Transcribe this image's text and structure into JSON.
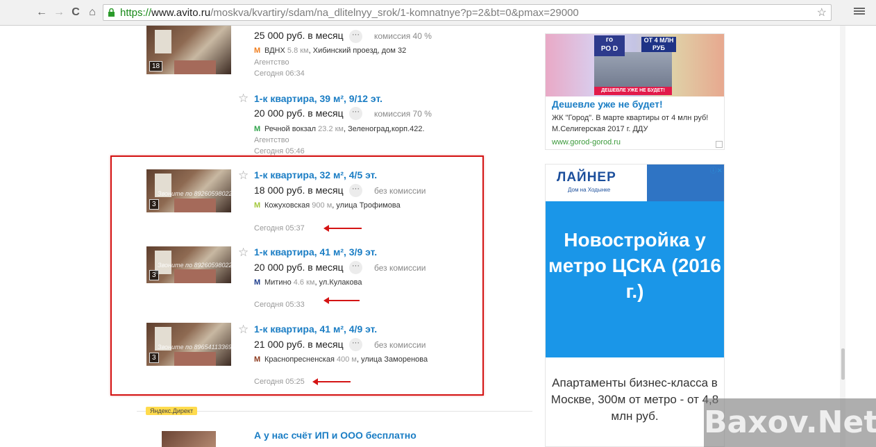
{
  "browser": {
    "url_scheme": "https://",
    "url_host": "www.avito.ru",
    "url_path": "/moskva/kvartiry/sdam/na_dlitelnyy_srok/1-komnatnye?p=2&bt=0&pmax=29000",
    "back_glyph": "←",
    "forward_glyph": "→",
    "reload_glyph": "C",
    "home_glyph": "⌂",
    "bookmark_glyph": "☆"
  },
  "listings": [
    {
      "title": "",
      "price": "25 000 руб. в месяц",
      "fee": "комиссия 40 %",
      "metro": "ВДНХ",
      "metro_color": "#f07e1e",
      "distance": "5.8 км",
      "address": "Хибинский проезд, дом 32",
      "agency": "Агентство",
      "date": "Сегодня 06:34",
      "photo_count": "18"
    },
    {
      "title": "1-к квартира, 39 м², 9/12 эт.",
      "price": "20 000 руб. в месяц",
      "fee": "комиссия 70 %",
      "metro": "Речной вокзал",
      "metro_color": "#2fa34a",
      "distance": "23.2 км",
      "address": "Зеленоград,корп.422.",
      "agency": "Агентство",
      "date": "Сегодня 05:46",
      "photo_count": ""
    },
    {
      "title": "1-к квартира, 32 м², 4/5 эт.",
      "price": "18 000 руб. в месяц",
      "fee": "без комиссии",
      "metro": "Кожуховская",
      "metro_color": "#a3c83c",
      "distance": "900 м",
      "address": "улица Трофимова",
      "agency": "",
      "date": "Сегодня 05:37",
      "photo_count": "3",
      "watermark": "Звоните по 89260598022"
    },
    {
      "title": "1-к квартира, 41 м², 3/9 эт.",
      "price": "20 000 руб. в месяц",
      "fee": "без комиссии",
      "metro": "Митино",
      "metro_color": "#1d3c8c",
      "distance": "4.6 км",
      "address": "ул.Кулакова",
      "agency": "",
      "date": "Сегодня 05:33",
      "photo_count": "3",
      "watermark": "Звоните по 89260598022"
    },
    {
      "title": "1-к квартира, 41 м², 4/9 эт.",
      "price": "21 000 руб. в месяц",
      "fee": "без комиссии",
      "metro": "Краснопресненская",
      "metro_color": "#8d3a1e",
      "distance": "400 м",
      "address": "улица Заморенова",
      "agency": "",
      "date": "Сегодня 05:25",
      "photo_count": "3",
      "watermark": "Звоните по 89654113369"
    }
  ],
  "direct": {
    "badge": "Яндекс.Директ",
    "title": "А у нас счёт ИП и ООО бесплатно"
  },
  "ad1": {
    "logo_top": "го",
    "logo_bottom": "РО D",
    "badge": "ОТ 4 МЛН РУБ",
    "banner": "ДЕШЕВЛЕ УЖЕ НЕ БУДЕТ!",
    "title": "Дешевле уже не будет!",
    "text": "ЖК \"Город\". В марте квартиры от 4 млн руб! М.Селигерская 2017 г. ДДУ",
    "link": "www.gorod-gorod.ru"
  },
  "ad2": {
    "logo": "ЛАЙНЕР",
    "logo_sub": "Дом на Ходынке",
    "headline": "Новостройка у метро ЦСКА (2016 г.)",
    "body": "Апартаменты бизнес-класса в Москве, 300м от метро - от 4,8 млн руб.",
    "adchoices": "ⓘ✕"
  },
  "watermark": "Baxov.Net",
  "colors": {
    "link": "#1a7dc4",
    "highlight": "#d41414",
    "ad2_blue": "#1a96e8"
  }
}
